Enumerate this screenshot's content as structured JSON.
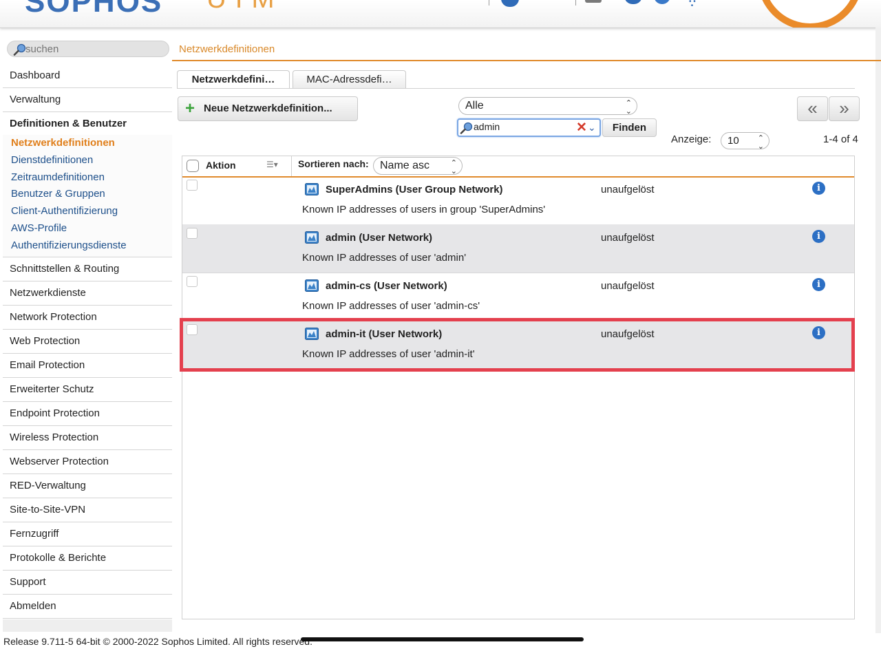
{
  "header": {
    "logo_primary": "SOPHOS",
    "logo_secondary": "UTM"
  },
  "search": {
    "placeholder": "suchen"
  },
  "sidebar": {
    "items_top": [
      {
        "label": "Dashboard"
      },
      {
        "label": "Verwaltung"
      }
    ],
    "active_group": {
      "label": "Definitionen & Benutzer",
      "children": [
        {
          "label": "Netzwerkdefinitionen",
          "active": true
        },
        {
          "label": "Dienstdefinitionen"
        },
        {
          "label": "Zeitraumdefinitionen"
        },
        {
          "label": "Benutzer & Gruppen"
        },
        {
          "label": "Client-Authentifizierung"
        },
        {
          "label": "AWS-Profile"
        },
        {
          "label": "Authentifizierungsdienste"
        }
      ]
    },
    "items_bottom": [
      {
        "label": "Schnittstellen & Routing"
      },
      {
        "label": "Netzwerkdienste"
      },
      {
        "label": "Network Protection"
      },
      {
        "label": "Web Protection"
      },
      {
        "label": "Email Protection"
      },
      {
        "label": "Erweiterter Schutz"
      },
      {
        "label": "Endpoint Protection"
      },
      {
        "label": "Wireless Protection"
      },
      {
        "label": "Webserver Protection"
      },
      {
        "label": "RED-Verwaltung"
      },
      {
        "label": "Site-to-Site-VPN"
      },
      {
        "label": "Fernzugriff"
      },
      {
        "label": "Protokolle & Berichte"
      },
      {
        "label": "Support"
      },
      {
        "label": "Abmelden"
      }
    ]
  },
  "breadcrumb": "Netzwerkdefinitionen",
  "tabs": [
    {
      "label": "Netzwerkdefini…",
      "active": true
    },
    {
      "label": "MAC-Adressdefi…",
      "active": false
    }
  ],
  "toolbar": {
    "new_button_label": "Neue Netzwerkdefinition...",
    "type_filter": "Alle",
    "filter_value": "admin",
    "find_label": "Finden",
    "prev_label": "«",
    "next_label": "»",
    "display_label": "Anzeige:",
    "display_value": "10",
    "result_count": "1-4 of 4"
  },
  "list": {
    "header": {
      "action_label": "Aktion",
      "sort_label": "Sortieren nach:",
      "sort_value": "Name asc"
    },
    "rows": [
      {
        "name": "SuperAdmins (User Group Network)",
        "status": "unaufgelöst",
        "description": "Known IP addresses of users in group 'SuperAdmins'"
      },
      {
        "name": "admin (User Network)",
        "status": "unaufgelöst",
        "description": "Known IP addresses of user 'admin'"
      },
      {
        "name": "admin-cs (User Network)",
        "status": "unaufgelöst",
        "description": "Known IP addresses of user 'admin-cs'"
      },
      {
        "name": "admin-it (User Network)",
        "status": "unaufgelöst",
        "description": "Known IP addresses of user 'admin-it'"
      }
    ],
    "highlighted_row": 3
  },
  "footer": {
    "text": "Release 9.711-5 64-bit  © 2000-2022 Sophos Limited. All rights reserved."
  },
  "colors": {
    "accent": "#e08a2b",
    "link": "#1d4f8a",
    "highlight": "#e4404e",
    "info": "#2c6fc4"
  }
}
